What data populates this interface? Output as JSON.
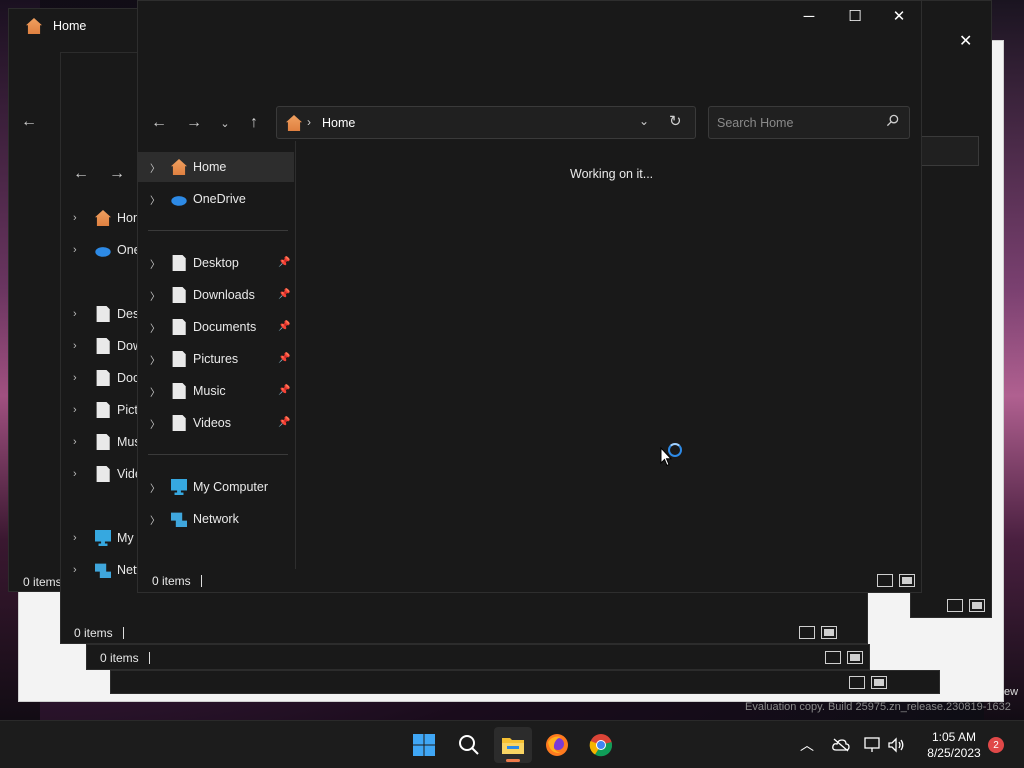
{
  "main": {
    "search_placeholder": "Search Home",
    "breadcrumb": "Home",
    "loading_text": "Working on it...",
    "status_text": "0 items",
    "nav": {
      "home": "Home",
      "onedrive": "OneDrive",
      "quick": [
        "Desktop",
        "Downloads",
        "Documents",
        "Pictures",
        "Music",
        "Videos"
      ],
      "my_computer": "My Computer",
      "network": "Network"
    }
  },
  "background_windows": {
    "top_left_title": "Home",
    "status_texts": [
      "0 items",
      "0 items",
      "0 items"
    ],
    "partial_nav": [
      "Hom",
      "One",
      "Desk",
      "Dow",
      "Docu",
      "Pictu",
      "Mus",
      "Vide",
      "My",
      "Netv"
    ]
  },
  "watermark": "Evaluation copy. Build 25975.zn_release.230819-1632",
  "partial_right_label": "ew",
  "taskbar": {
    "time": "1:05 AM",
    "date": "8/25/2023",
    "notification_count": "2",
    "accent": "#ef7a4a"
  }
}
